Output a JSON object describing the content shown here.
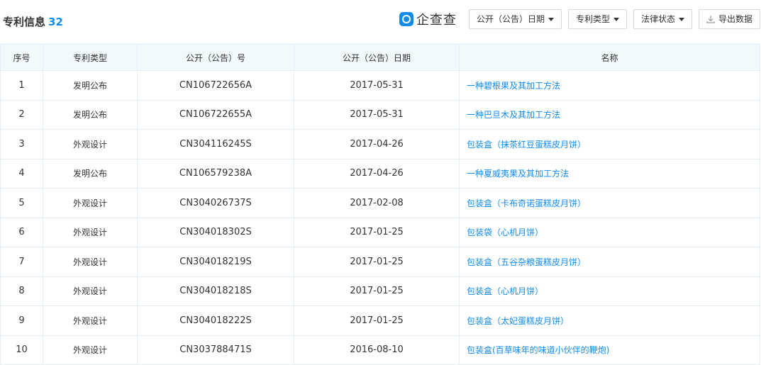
{
  "header": {
    "title": "专利信息",
    "count": "32"
  },
  "brand": {
    "name": "企查查",
    "icon": "qichacha-logo-icon"
  },
  "toolbar": {
    "filters": [
      {
        "label": "公开（公告）日期"
      },
      {
        "label": "专利类型"
      },
      {
        "label": "法律状态"
      }
    ],
    "export_label": "导出数据",
    "export_icon": "download-icon"
  },
  "table": {
    "columns": [
      "序号",
      "专利类型",
      "公开（公告）号",
      "公开（公告）日期",
      "名称"
    ],
    "rows": [
      {
        "index": "1",
        "type": "发明公布",
        "number": "CN106722656A",
        "date": "2017-05-31",
        "name": "一种碧根果及其加工方法"
      },
      {
        "index": "2",
        "type": "发明公布",
        "number": "CN106722655A",
        "date": "2017-05-31",
        "name": "一种巴旦木及其加工方法"
      },
      {
        "index": "3",
        "type": "外观设计",
        "number": "CN304116245S",
        "date": "2017-04-26",
        "name": "包装盒（抹茶红豆蛋糕皮月饼）"
      },
      {
        "index": "4",
        "type": "发明公布",
        "number": "CN106579238A",
        "date": "2017-04-26",
        "name": "一种夏威夷果及其加工方法"
      },
      {
        "index": "5",
        "type": "外观设计",
        "number": "CN304026737S",
        "date": "2017-02-08",
        "name": "包装盒（卡布奇诺蛋糕皮月饼）"
      },
      {
        "index": "6",
        "type": "外观设计",
        "number": "CN304018302S",
        "date": "2017-01-25",
        "name": "包装袋（心机月饼）"
      },
      {
        "index": "7",
        "type": "外观设计",
        "number": "CN304018219S",
        "date": "2017-01-25",
        "name": "包装盒（五谷杂粮蛋糕皮月饼）"
      },
      {
        "index": "8",
        "type": "外观设计",
        "number": "CN304018218S",
        "date": "2017-01-25",
        "name": "包装盒（心机月饼）"
      },
      {
        "index": "9",
        "type": "外观设计",
        "number": "CN304018222S",
        "date": "2017-01-25",
        "name": "包装盒（太妃蛋糕皮月饼）"
      },
      {
        "index": "10",
        "type": "外观设计",
        "number": "CN303788471S",
        "date": "2016-08-10",
        "name": "包装盒(百草味年的味道小伙伴的鞭炮)"
      }
    ]
  },
  "colors": {
    "accent": "#128bed",
    "header_bg": "#f2f9fc",
    "border": "#e4eef6"
  }
}
